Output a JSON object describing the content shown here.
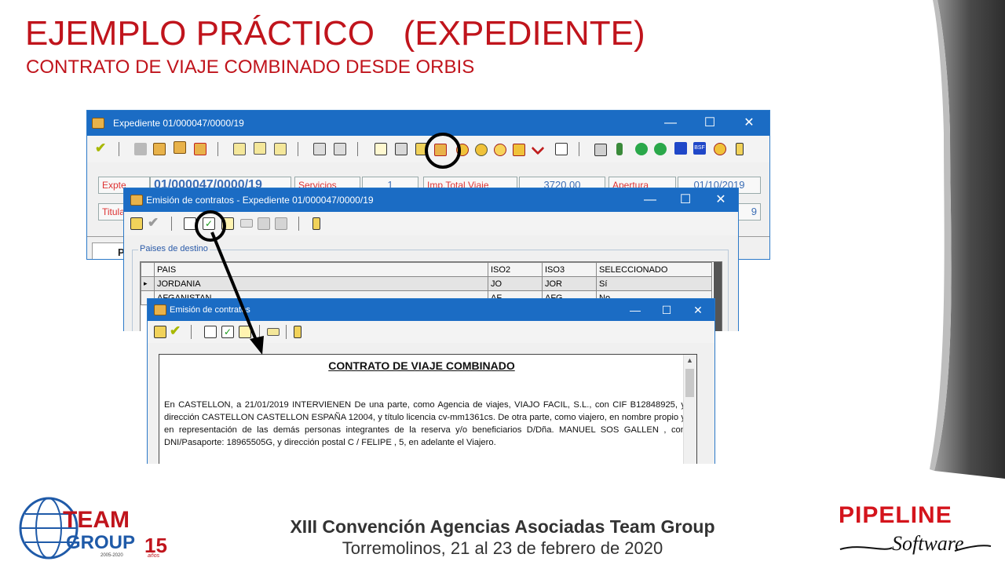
{
  "slide": {
    "title": "EJEMPLO PRÁCTICO   (EXPEDIENTE)",
    "subtitle": "CONTRATO DE VIAJE COMBINADO DESDE ORBIS",
    "footer_line1": "XIII Convención  Agencias Asociadas Team Group",
    "footer_line2": "Torremolinos, 21 al 23 de febrero de 2020"
  },
  "logos": {
    "team_group": {
      "line1": "TEAM",
      "line2": "GROUP",
      "number": "15",
      "years": "2005-2020",
      "suffix": "años"
    },
    "pipeline": {
      "name": "PIPELINE",
      "script": "Software"
    }
  },
  "window_expediente": {
    "title": "Expediente 01/000047/0000/19",
    "controls": {
      "minimize": "—",
      "maximize": "☐",
      "close": "✕"
    },
    "fields": {
      "expte_label": "Expte",
      "expte_value": "01/000047/0000/19",
      "servicios_label": "Servicios",
      "servicios_value": "1",
      "imp_total_label": "Imp.Total Viaje",
      "imp_total_value": "3720,00",
      "apertura_label": "Apertura",
      "apertura_value": "01/10/2019",
      "titular_label": "Titula",
      "second_date_value": "9"
    },
    "tab_label": "P",
    "toolbar_icon_names": [
      "accept-icon",
      "open-folder-icon",
      "folder-icon",
      "new-folder-icon",
      "delete-icon",
      "copy-icon",
      "document-icon",
      "folder-list-icon",
      "print-icon",
      "print-preview-icon",
      "list-icon",
      "settings-icon",
      "card-icon",
      "contract-icon",
      "money-icon",
      "clock-icon",
      "check-doc-icon",
      "stamp-icon",
      "tools-icon",
      "note-icon",
      "export-icon",
      "bottle-icon",
      "whatsapp-icon",
      "whatsapp-icon",
      "bank-icon",
      "bsf-icon",
      "lock-icon",
      "exit-icon"
    ],
    "highlight_color": "#000000"
  },
  "window_emision_1": {
    "title": "Emisión de contratos - Expediente 01/000047/0000/19",
    "controls": {
      "minimize": "—",
      "maximize": "☐",
      "close": "✕"
    },
    "group_label": "Paises de destino",
    "table": {
      "headers": [
        "PAIS",
        "ISO2",
        "ISO3",
        "SELECCIONADO"
      ],
      "rows": [
        {
          "pais": "JORDANIA",
          "iso2": "JO",
          "iso3": "JOR",
          "sel": "Sí",
          "current": true
        },
        {
          "pais": "AFGANISTAN",
          "iso2": "AF",
          "iso3": "AFG",
          "sel": "No",
          "current": false
        }
      ],
      "row_pointer": "▸"
    }
  },
  "window_emision_2": {
    "title": "Emisión de contratos",
    "controls": {
      "minimize": "—",
      "maximize": "☐",
      "close": "✕"
    },
    "document": {
      "heading": "CONTRATO DE VIAJE COMBINADO",
      "paragraph": "En CASTELLON, a 21/01/2019 INTERVIENEN De una parte, como Agencia de viajes, VIAJO FACIL, S.L., con CIF B12848925, y dirección CASTELLON CASTELLON ESPAÑA 12004, y título licencia cv-mm1361cs. De otra parte, como viajero, en nombre propio y en representación de las demás personas integrantes de la reserva y/o beneficiarios D/Dña. MANUEL SOS GALLEN  , con DNI/Pasaporte: 18965505G, y dirección postal C / FELIPE , 5, en adelante el Viajero."
    }
  },
  "colors": {
    "title_red": "#c0141c",
    "window_blue": "#1b6cc4",
    "team_blue": "#1f5aa8",
    "pipeline_red": "#d4141c"
  }
}
